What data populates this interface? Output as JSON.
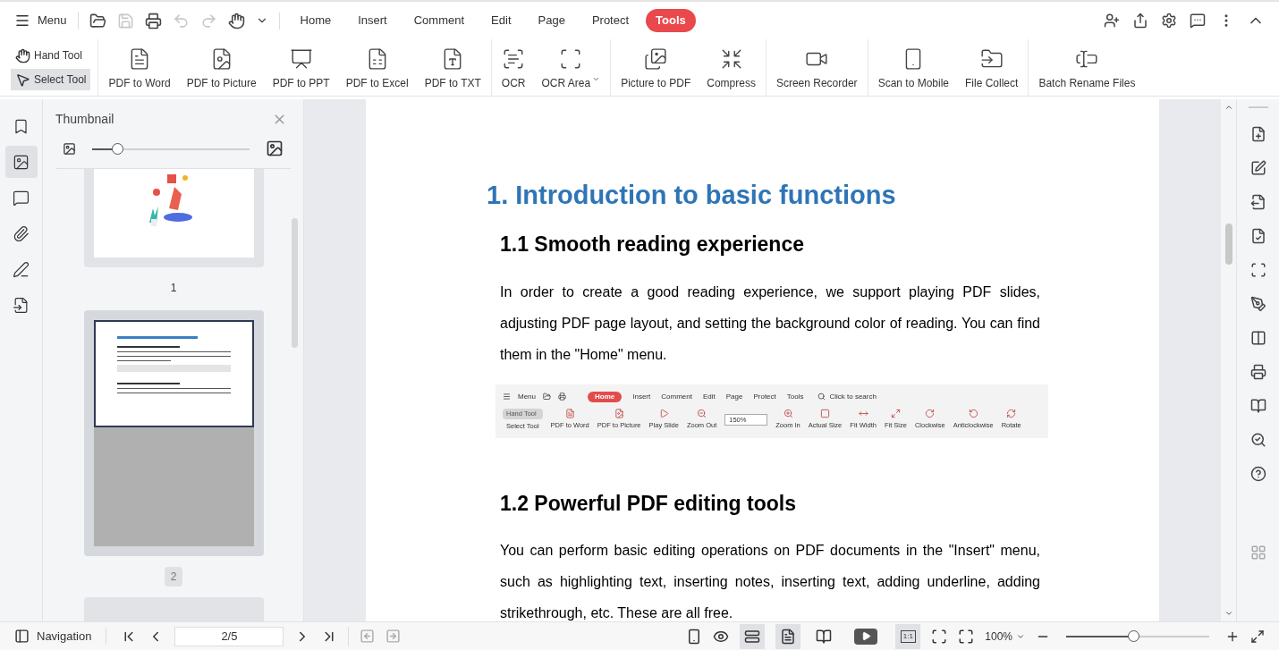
{
  "menu_bar": {
    "menu_label": "Menu",
    "quick_actions": [
      {
        "kind": "open",
        "disabled": false
      },
      {
        "kind": "save",
        "disabled": true
      },
      {
        "kind": "print",
        "disabled": false
      },
      {
        "kind": "undo",
        "disabled": true
      },
      {
        "kind": "redo",
        "disabled": true
      },
      {
        "kind": "hand",
        "disabled": false
      },
      {
        "kind": "more",
        "disabled": false
      }
    ],
    "tabs": [
      {
        "label": "Home",
        "selected": false
      },
      {
        "label": "Insert",
        "selected": false
      },
      {
        "label": "Comment",
        "selected": false
      },
      {
        "label": "Edit",
        "selected": false
      },
      {
        "label": "Page",
        "selected": false
      },
      {
        "label": "Protect",
        "selected": false
      },
      {
        "label": "Tools",
        "selected": true
      }
    ]
  },
  "ribbon": {
    "modes": [
      {
        "label": "Hand Tool",
        "kind": "hand",
        "selected": false
      },
      {
        "label": "Select Tool",
        "kind": "select",
        "selected": true
      }
    ],
    "groups": [
      [
        {
          "label": "PDF to Word",
          "kind": "word",
          "dropdown": false
        },
        {
          "label": "PDF to Picture",
          "kind": "picture",
          "dropdown": false
        },
        {
          "label": "PDF to PPT",
          "kind": "ppt",
          "dropdown": false
        },
        {
          "label": "PDF to Excel",
          "kind": "excel",
          "dropdown": false
        },
        {
          "label": "PDF to TXT",
          "kind": "txt",
          "dropdown": false
        }
      ],
      [
        {
          "label": "OCR",
          "kind": "ocr",
          "dropdown": false
        },
        {
          "label": "OCR Area",
          "kind": "ocr_area",
          "dropdown": true
        }
      ],
      [
        {
          "label": "Picture to PDF",
          "kind": "pic2pdf",
          "dropdown": false
        },
        {
          "label": "Compress",
          "kind": "compress",
          "dropdown": false
        }
      ],
      [
        {
          "label": "Screen Recorder",
          "kind": "recorder",
          "dropdown": false
        }
      ],
      [
        {
          "label": "Scan to Mobile",
          "kind": "mobile",
          "dropdown": false
        },
        {
          "label": "File Collect",
          "kind": "collect",
          "dropdown": false
        }
      ],
      [
        {
          "label": "Batch Rename Files",
          "kind": "rename",
          "dropdown": false
        }
      ]
    ]
  },
  "sidebar": {
    "items": [
      {
        "kind": "bookmark",
        "selected": false
      },
      {
        "kind": "thumbnail",
        "selected": true
      },
      {
        "kind": "comment",
        "selected": false
      },
      {
        "kind": "attachment",
        "selected": false
      },
      {
        "kind": "signature",
        "selected": false
      },
      {
        "kind": "convert",
        "selected": false
      }
    ]
  },
  "thumbnail_panel": {
    "title": "Thumbnail",
    "size_slider": {
      "level": 0.16
    },
    "pages": [
      {
        "label": "1",
        "kind": "illustration",
        "selected": false
      },
      {
        "label": "2",
        "kind": "text",
        "selected": true
      }
    ]
  },
  "document": {
    "heading": "1. Introduction to basic functions",
    "sections": [
      {
        "title": "1.1 Smooth reading experience",
        "paragraph": "In order to create a good reading experience, we support playing PDF slides, adjusting PDF page layout, and setting the background color of reading. You can find them in the \"Home\" menu.",
        "figure": {
          "menu_label": "Menu",
          "tabs": [
            {
              "label": "Home",
              "selected": true
            },
            {
              "label": "Insert",
              "selected": false
            },
            {
              "label": "Comment",
              "selected": false
            },
            {
              "label": "Edit",
              "selected": false
            },
            {
              "label": "Page",
              "selected": false
            },
            {
              "label": "Protect",
              "selected": false
            },
            {
              "label": "Tools",
              "selected": false
            }
          ],
          "search_placeholder": "Click to search",
          "modes": [
            {
              "label": "Hand Tool",
              "selected": true
            },
            {
              "label": "Select Tool",
              "selected": false
            }
          ],
          "tools": [
            {
              "label": "PDF to Word",
              "kind": "word"
            },
            {
              "label": "PDF to Picture",
              "kind": "picture"
            },
            {
              "label": "Play Slide",
              "kind": "play"
            },
            {
              "label": "Zoom Out",
              "kind": "zoom_out"
            },
            {
              "label": "150%",
              "kind": "zoom_select"
            },
            {
              "label": "Zoom In",
              "kind": "zoom_in"
            },
            {
              "label": "Actual Size",
              "kind": "actual"
            },
            {
              "label": "Fit Width",
              "kind": "fit_width"
            },
            {
              "label": "Fit Size",
              "kind": "fit_size"
            },
            {
              "label": "Clockwise",
              "kind": "cw"
            },
            {
              "label": "Anticlockwise",
              "kind": "ccw"
            },
            {
              "label": "Rotate",
              "kind": "rotate"
            }
          ]
        }
      },
      {
        "title": "1.2 Powerful PDF editing tools",
        "paragraph": "You can perform basic editing operations on PDF documents in the \"Insert\" menu, such as highlighting text, inserting notes, inserting text, adding underline, adding strikethrough, etc. These are all free."
      }
    ]
  },
  "status_bar": {
    "navigation_label": "Navigation",
    "page_field": "2/5",
    "actual_size_label": "1:1",
    "zoom": "100%",
    "zoom_slider": {
      "level": 0.47
    },
    "views": [
      {
        "kind": "continuous",
        "selected": true
      },
      {
        "kind": "single",
        "selected": true
      },
      {
        "kind": "double",
        "selected": false
      }
    ],
    "actual_size_selected": true
  }
}
